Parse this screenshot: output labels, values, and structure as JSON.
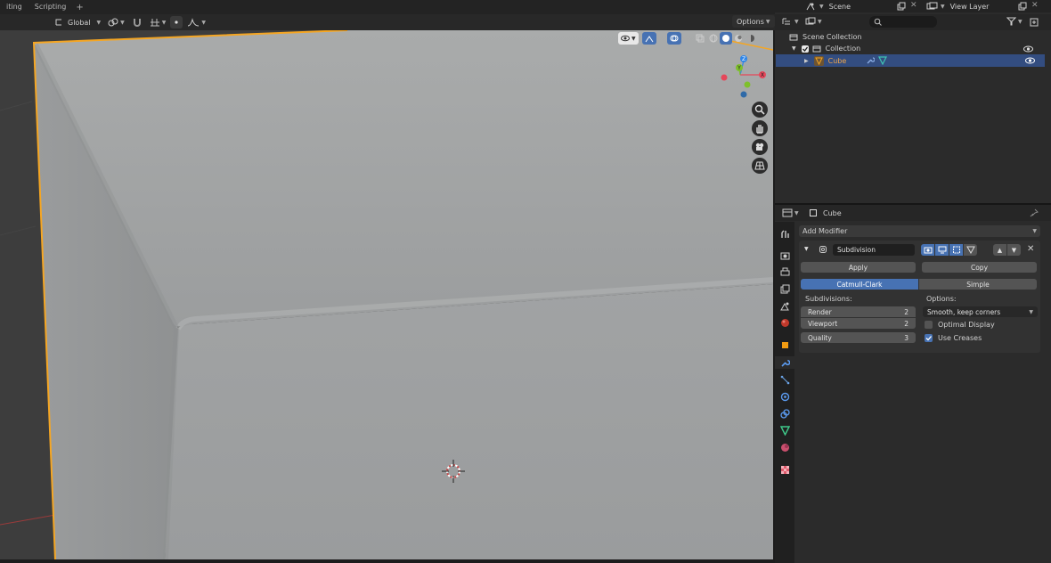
{
  "topbar": {
    "tabs": [
      "iting",
      "Scripting"
    ],
    "plus": "+"
  },
  "viewport_header": {
    "orientation": "Global",
    "options_label": "Options"
  },
  "scene_header": {
    "scene": "Scene",
    "view_layer": "View Layer"
  },
  "outliner": {
    "scene_collection": "Scene Collection",
    "collection": "Collection",
    "object": "Cube"
  },
  "properties": {
    "object_name": "Cube",
    "add_modifier": "Add Modifier",
    "modifier": {
      "name": "Subdivision",
      "apply": "Apply",
      "copy": "Copy",
      "mode_catmull": "Catmull-Clark",
      "mode_simple": "Simple",
      "subdivisions_label": "Subdivisions:",
      "options_label": "Options:",
      "render_label": "Render",
      "render_value": "2",
      "viewport_label": "Viewport",
      "viewport_value": "2",
      "quality_label": "Quality",
      "quality_value": "3",
      "uv_smooth": "Smooth, keep corners",
      "optimal_display": "Optimal Display",
      "optimal_display_checked": false,
      "use_creases": "Use Creases",
      "use_creases_checked": true
    }
  },
  "gizmo": {
    "x": "X",
    "y": "Y",
    "z": "Z"
  },
  "colors": {
    "selection": "#4772b3",
    "outline": "#f5a623",
    "axis_x": "#e5475a",
    "axis_y": "#7ec02b",
    "axis_z": "#2f86e8"
  }
}
